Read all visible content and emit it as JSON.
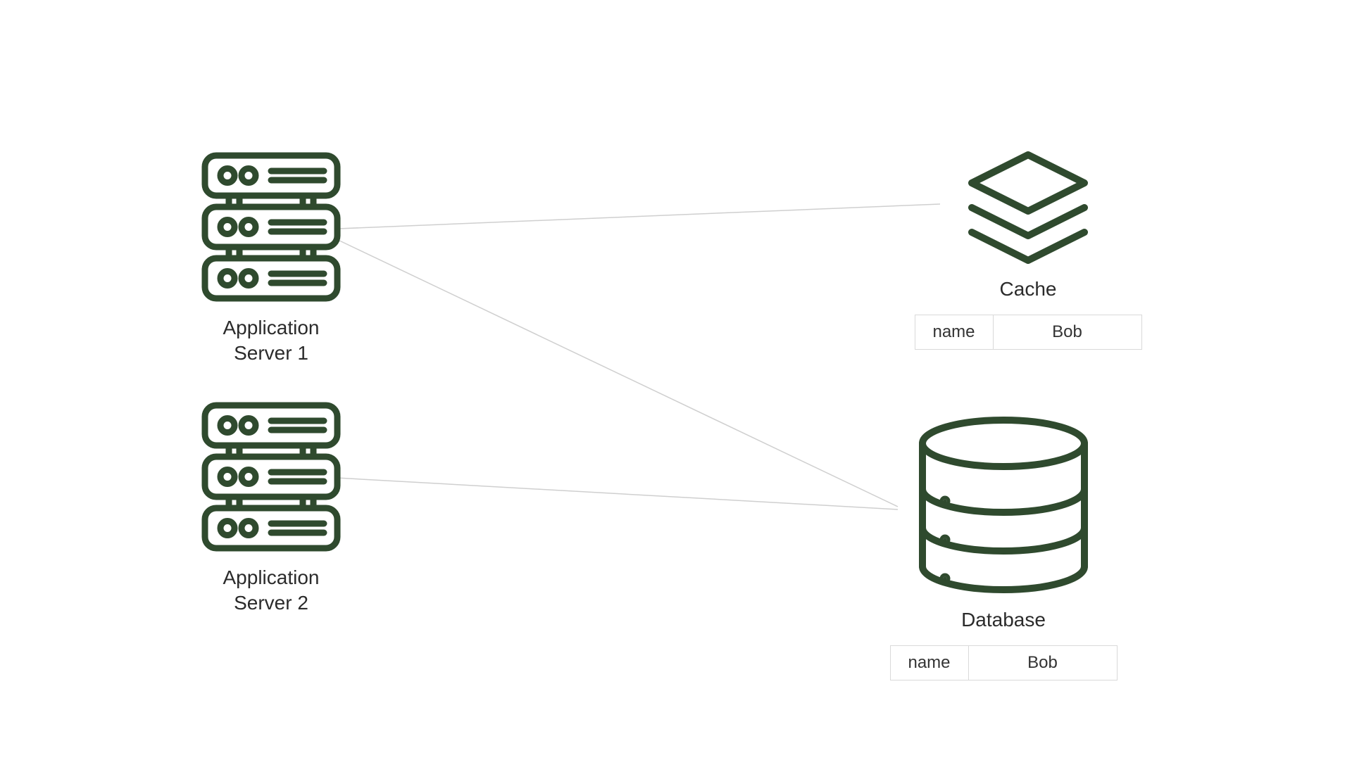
{
  "colors": {
    "stroke": "#2f4a2e",
    "line": "#cfcfcf",
    "border": "#d9d9d9"
  },
  "nodes": {
    "app1": {
      "label_line1": "Application",
      "label_line2": "Server 1"
    },
    "app2": {
      "label_line1": "Application",
      "label_line2": "Server 2"
    },
    "cache": {
      "label": "Cache"
    },
    "database": {
      "label": "Database"
    }
  },
  "cache_entry": {
    "key": "name",
    "value": "Bob"
  },
  "database_entry": {
    "key": "name",
    "value": "Bob"
  }
}
